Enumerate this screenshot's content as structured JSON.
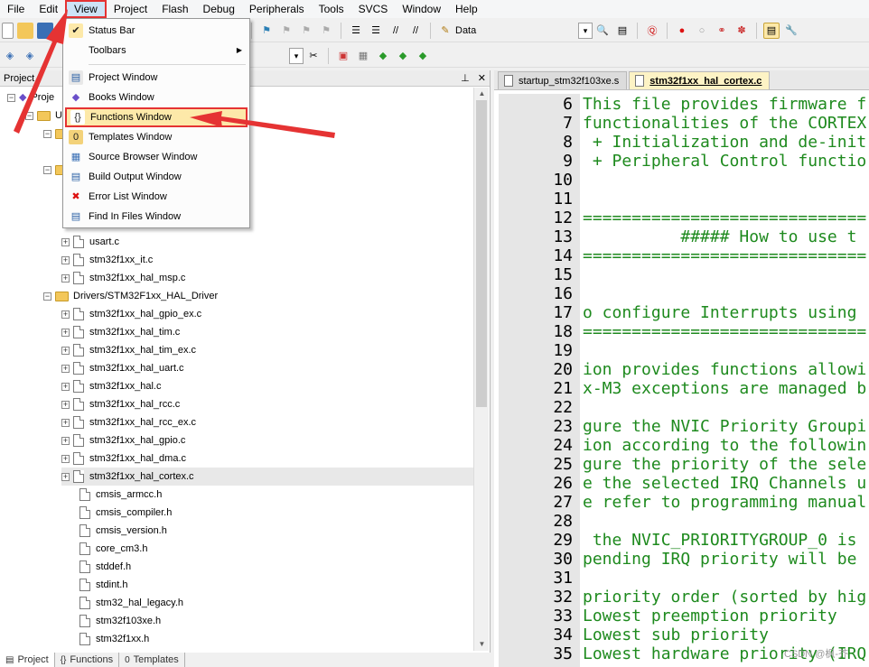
{
  "menubar": {
    "items": [
      "File",
      "Edit",
      "View",
      "Project",
      "Flash",
      "Debug",
      "Peripherals",
      "Tools",
      "SVCS",
      "Window",
      "Help"
    ],
    "active": "View"
  },
  "toolbar": {
    "target_label": "Data"
  },
  "view_menu": {
    "items": [
      {
        "label": "Status Bar",
        "icon": "check-icon",
        "checked": true
      },
      {
        "label": "Toolbars",
        "icon": "",
        "submenu": true
      },
      {
        "label": "Project Window",
        "icon": "project-window-icon"
      },
      {
        "label": "Books Window",
        "icon": "books-icon"
      },
      {
        "label": "Functions Window",
        "icon": "functions-icon",
        "highlighted": true
      },
      {
        "label": "Templates Window",
        "icon": "templates-icon"
      },
      {
        "label": "Source Browser Window",
        "icon": "source-browser-icon"
      },
      {
        "label": "Build Output Window",
        "icon": "build-output-icon"
      },
      {
        "label": "Error List Window",
        "icon": "error-list-icon"
      },
      {
        "label": "Find In Files Window",
        "icon": "find-in-files-icon"
      }
    ]
  },
  "project_panel": {
    "title": "Project",
    "tree": [
      {
        "label": "Proje",
        "type": "root"
      },
      {
        "label": "U",
        "type": "target"
      },
      {
        "label": "",
        "type": "folder-partial"
      },
      {
        "label": "",
        "type": "folder-partial"
      },
      {
        "label": "usart.c",
        "type": "file"
      },
      {
        "label": "stm32f1xx_it.c",
        "type": "file"
      },
      {
        "label": "stm32f1xx_hal_msp.c",
        "type": "file"
      },
      {
        "label": "Drivers/STM32F1xx_HAL_Driver",
        "type": "folder"
      },
      {
        "label": "stm32f1xx_hal_gpio_ex.c",
        "type": "file"
      },
      {
        "label": "stm32f1xx_hal_tim.c",
        "type": "file"
      },
      {
        "label": "stm32f1xx_hal_tim_ex.c",
        "type": "file"
      },
      {
        "label": "stm32f1xx_hal_uart.c",
        "type": "file"
      },
      {
        "label": "stm32f1xx_hal.c",
        "type": "file"
      },
      {
        "label": "stm32f1xx_hal_rcc.c",
        "type": "file"
      },
      {
        "label": "stm32f1xx_hal_rcc_ex.c",
        "type": "file"
      },
      {
        "label": "stm32f1xx_hal_gpio.c",
        "type": "file"
      },
      {
        "label": "stm32f1xx_hal_dma.c",
        "type": "file"
      },
      {
        "label": "stm32f1xx_hal_cortex.c",
        "type": "file",
        "selected": true
      },
      {
        "label": "cmsis_armcc.h",
        "type": "header"
      },
      {
        "label": "cmsis_compiler.h",
        "type": "header"
      },
      {
        "label": "cmsis_version.h",
        "type": "header"
      },
      {
        "label": "core_cm3.h",
        "type": "header"
      },
      {
        "label": "stddef.h",
        "type": "header"
      },
      {
        "label": "stdint.h",
        "type": "header"
      },
      {
        "label": "stm32_hal_legacy.h",
        "type": "header"
      },
      {
        "label": "stm32f103xe.h",
        "type": "header"
      },
      {
        "label": "stm32f1xx.h",
        "type": "header"
      }
    ]
  },
  "bottom_tabs": [
    "Project",
    "Functions",
    "Templates"
  ],
  "editor": {
    "tabs": [
      {
        "label": "startup_stm32f103xe.s",
        "active": false
      },
      {
        "label": "stm32f1xx_hal_cortex.c",
        "active": true
      }
    ],
    "lines": [
      {
        "n": "6",
        "t": "This file provides firmware f"
      },
      {
        "n": "7",
        "t": "functionalities of the CORTEX"
      },
      {
        "n": "8",
        "t": " + Initialization and de-init"
      },
      {
        "n": "9",
        "t": " + Peripheral Control functio"
      },
      {
        "n": "10",
        "t": ""
      },
      {
        "n": "11",
        "t": ""
      },
      {
        "n": "12",
        "t": "============================="
      },
      {
        "n": "13",
        "t": "          ##### How to use t"
      },
      {
        "n": "14",
        "t": "============================="
      },
      {
        "n": "15",
        "t": ""
      },
      {
        "n": "16",
        "t": ""
      },
      {
        "n": "17",
        "t": "o configure Interrupts using"
      },
      {
        "n": "18",
        "t": "============================="
      },
      {
        "n": "19",
        "t": ""
      },
      {
        "n": "20",
        "t": "ion provides functions allowi"
      },
      {
        "n": "21",
        "t": "x-M3 exceptions are managed b"
      },
      {
        "n": "22",
        "t": ""
      },
      {
        "n": "23",
        "t": "gure the NVIC Priority Groupi"
      },
      {
        "n": "24",
        "t": "ion according to the followin"
      },
      {
        "n": "25",
        "t": "gure the priority of the sele"
      },
      {
        "n": "26",
        "t": "e the selected IRQ Channels u"
      },
      {
        "n": "27",
        "t": "e refer to programming manual"
      },
      {
        "n": "28",
        "t": ""
      },
      {
        "n": "29",
        "t": " the NVIC_PRIORITYGROUP_0 is "
      },
      {
        "n": "30",
        "t": "pending IRQ priority will be "
      },
      {
        "n": "31",
        "t": ""
      },
      {
        "n": "32",
        "t": "priority order (sorted by hig"
      },
      {
        "n": "33",
        "t": "Lowest preemption priority"
      },
      {
        "n": "34",
        "t": "Lowest sub priority"
      },
      {
        "n": "35",
        "t": "Lowest hardware priority (IRQ"
      }
    ]
  },
  "watermark": "CSDN @枫-芥"
}
